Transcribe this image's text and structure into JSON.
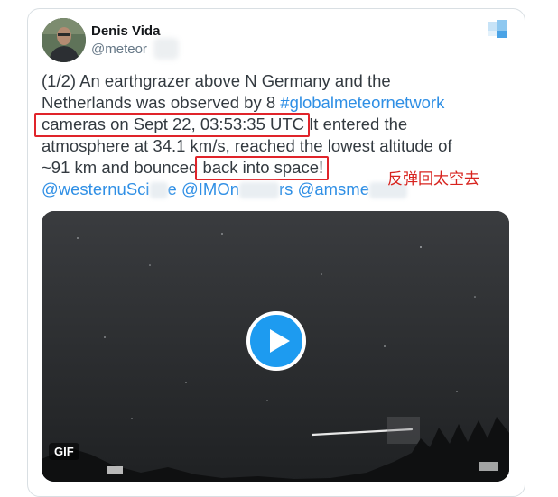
{
  "tweet": {
    "author": {
      "display_name": "Denis Vida",
      "handle_visible": "@meteor",
      "avatar_icon": "person-avatar-icon"
    },
    "text": {
      "line1": "(1/2) An earthgrazer above N Germany and the",
      "line2_prefix": "Netherlands was observed by 8 ",
      "hashtag": "#globalmeteornetwork",
      "line3_highlight": "cameras on Sept 22, 03:53:35 UTC",
      "line3_rest": " It entered the",
      "line4": "atmosphere at 34.1 km/s, reached the lowest altitude of",
      "line5_prefix": "~91 km and bounced ",
      "line5_highlight": "back into space!",
      "mention1_visible": "@westernuSci",
      "mention1_tail": "e",
      "mention2_visible": "@IMOn",
      "mention2_tail": "rs",
      "mention3_visible": "@amsme"
    },
    "annotation": "反弹回太空去",
    "media": {
      "type": "GIF",
      "badge": "GIF",
      "play_icon": "play-icon"
    }
  },
  "colors": {
    "link": "#2f8fe5",
    "highlight_box": "#e0242a",
    "annotation_text": "#d8241f",
    "play_button": "#1d9bf0"
  },
  "brand_icon": "blurred-logo-icon"
}
